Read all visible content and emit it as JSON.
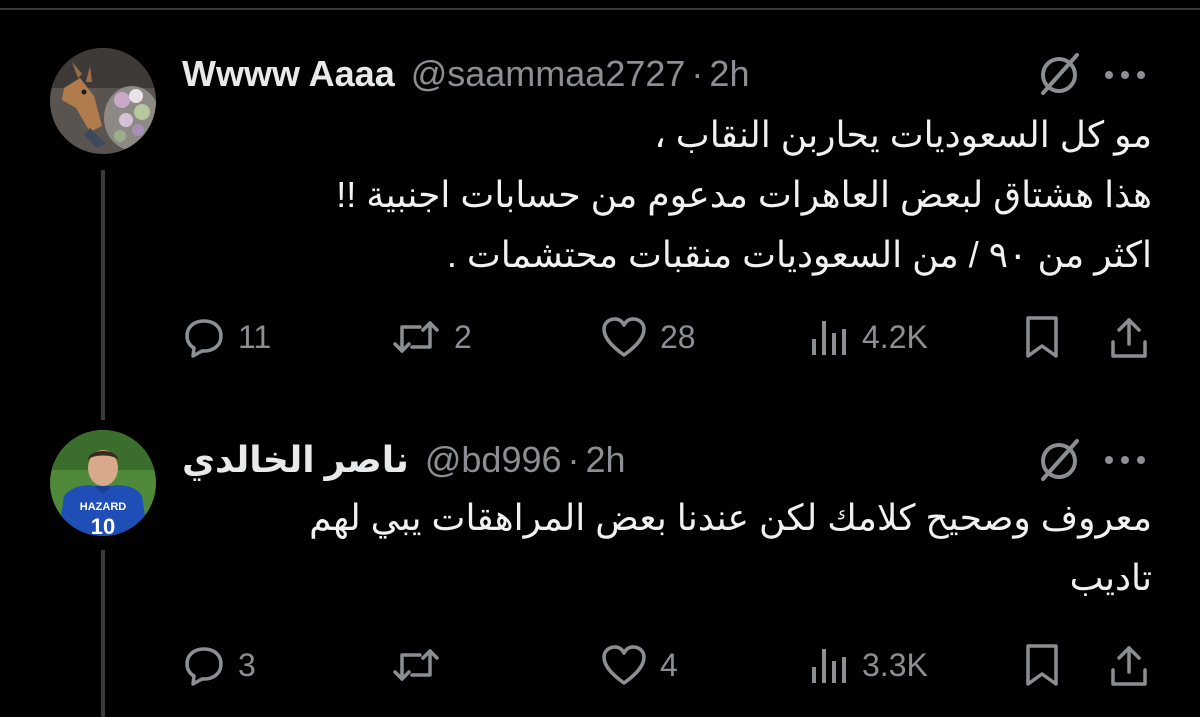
{
  "tweets": [
    {
      "display_name": "Wwww Aaaa",
      "handle": "@saammaa2727",
      "separator": "·",
      "time": "2h",
      "body_lines": [
        "مو كل السعوديات يحاربن النقاب ،",
        "هذا هشتاق لبعض العاهرات مدعوم من حسابات اجنبية !!",
        "اكثر من ٩٠ / من السعوديات منقبات محتشمات ."
      ],
      "actions": {
        "replies": "11",
        "retweets": "2",
        "likes": "28",
        "views": "4.2K"
      },
      "avatar": "deer-with-flowers"
    },
    {
      "display_name": "ناصر الخالدي",
      "handle": "@bd996",
      "separator": "·",
      "time": "2h",
      "body_lines": [
        "معروف وصحيح كلامك لكن عندنا بعض المراهقات يبي لهم",
        "تاديب"
      ],
      "actions": {
        "replies": "3",
        "retweets": "",
        "likes": "4",
        "views": "3.3K"
      },
      "avatar_jersey_text": "HAZARD",
      "avatar_jersey_number": "10"
    }
  ],
  "colors": {
    "background": "#000000",
    "text": "#e7e9ea",
    "muted": "#8b8f94",
    "divider": "#3a3a3a"
  }
}
